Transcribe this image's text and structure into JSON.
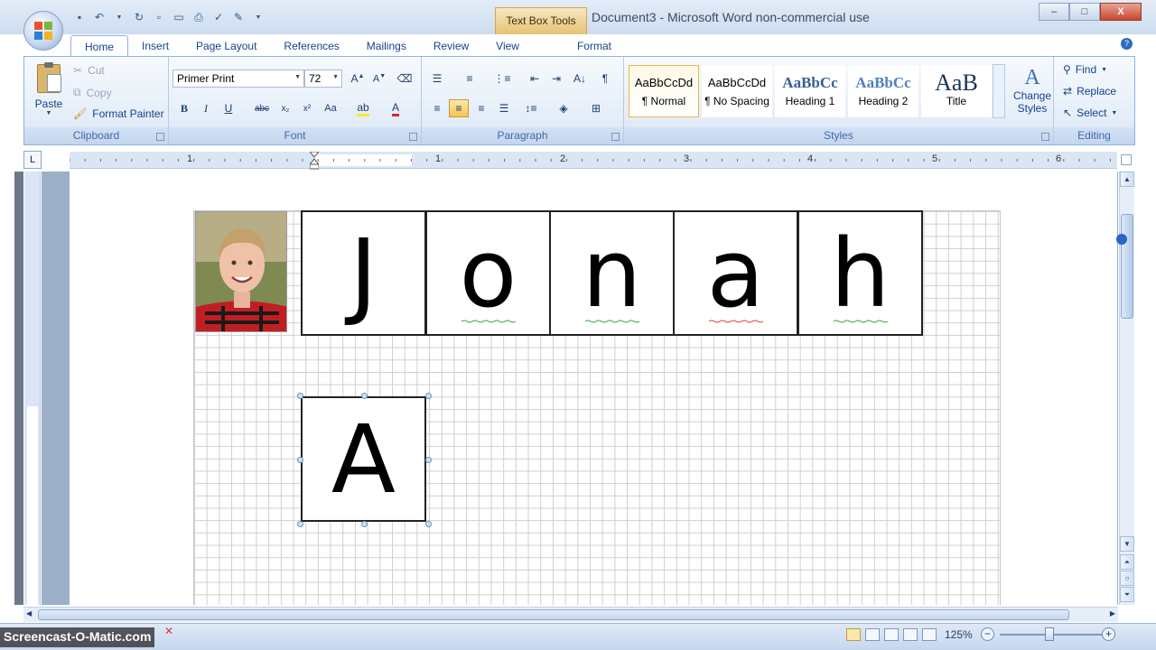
{
  "window": {
    "title": "Document3 - Microsoft Word non-commercial use",
    "contextual_tab_header": "Text Box Tools",
    "controls": {
      "minimize": "–",
      "maximize": "□",
      "close": "X"
    }
  },
  "tabs": [
    {
      "label": "Home",
      "active": true
    },
    {
      "label": "Insert"
    },
    {
      "label": "Page Layout"
    },
    {
      "label": "References"
    },
    {
      "label": "Mailings"
    },
    {
      "label": "Review"
    },
    {
      "label": "View"
    },
    {
      "label": "Format"
    }
  ],
  "ribbon": {
    "clipboard": {
      "label": "Clipboard",
      "paste": "Paste",
      "cut": "Cut",
      "copy": "Copy",
      "format_painter": "Format Painter"
    },
    "font": {
      "label": "Font",
      "font_name": "Primer Print",
      "font_size": "72"
    },
    "paragraph": {
      "label": "Paragraph"
    },
    "styles": {
      "label": "Styles",
      "change_styles": [
        "Change",
        "Styles"
      ],
      "items": [
        {
          "sample": "AaBbCcDd",
          "name": "¶ Normal"
        },
        {
          "sample": "AaBbCcDd",
          "name": "¶ No Spacing"
        },
        {
          "sample": "AaBbCc",
          "name": "Heading 1"
        },
        {
          "sample": "AaBbCc",
          "name": "Heading 2"
        },
        {
          "sample": "AaB",
          "name": "Title"
        }
      ]
    },
    "editing": {
      "label": "Editing",
      "find": "Find",
      "replace": "Replace",
      "select": "Select"
    }
  },
  "ruler": {
    "numbers": [
      "1",
      "1",
      "2",
      "3",
      "4",
      "5",
      "6"
    ],
    "corner": "L"
  },
  "document": {
    "name_letters": [
      "J",
      "o",
      "n",
      "a",
      "h"
    ],
    "selected_letter": "A"
  },
  "status": {
    "zoom": "125%",
    "watermark": "Screencast-O-Matic.com"
  },
  "colors": {
    "ribbon_blue": "#15428b",
    "selection_gold": "#f7c454",
    "spell_red": "#e03b3b",
    "grammar_green": "#3aa13a"
  }
}
